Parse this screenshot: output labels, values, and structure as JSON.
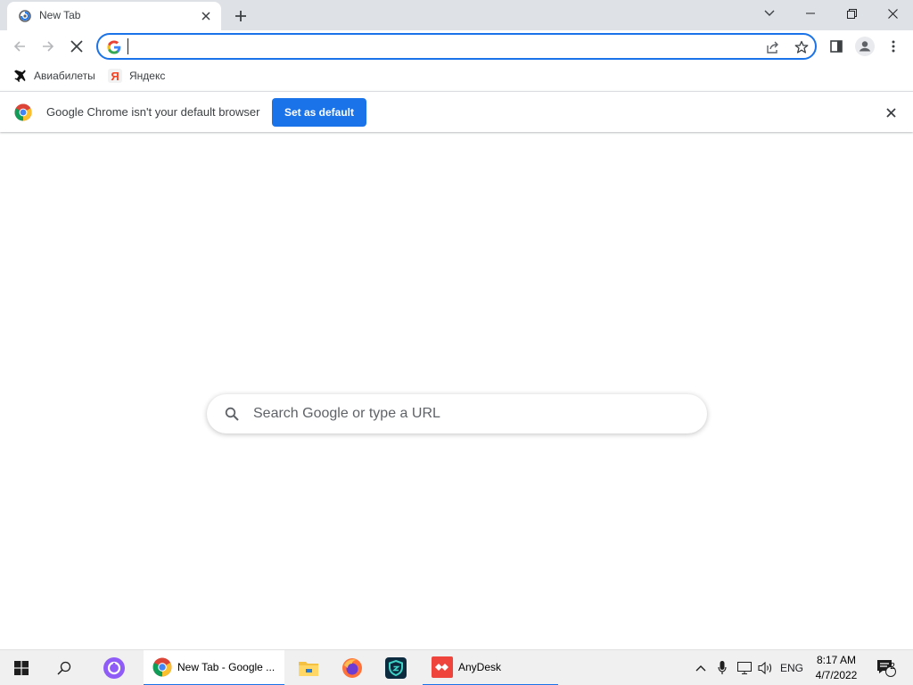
{
  "browser": {
    "tab": {
      "title": "New Tab",
      "favicon": "loading-spinner-icon",
      "close_icon": "close-icon"
    },
    "new_tab_icon": "plus-icon",
    "window_controls": [
      "chevron-down-icon",
      "minimize-icon",
      "restore-icon",
      "close-icon"
    ]
  },
  "toolbar": {
    "buttons": [
      "back-icon",
      "forward-icon",
      "stop-loading-icon"
    ],
    "omnibox": {
      "value": "",
      "placeholder": "",
      "leading_icon": "google-g-icon"
    },
    "omnibox_actions": [
      "share-icon",
      "bookmark-star-icon"
    ],
    "right_buttons": [
      "side-panel-icon",
      "profile-icon",
      "menu-icon"
    ]
  },
  "bookmarks": [
    {
      "label": "Авиабилеты",
      "icon": "airplane-icon"
    },
    {
      "label": "Яндекс",
      "icon": "yandex-icon"
    }
  ],
  "infobar": {
    "message": "Google Chrome isn't your default browser",
    "button": "Set as default",
    "logo": "chrome-logo-icon"
  },
  "ntp": {
    "search_placeholder": "Search Google or type a URL"
  },
  "taskbar": {
    "apps": [
      {
        "label": "New Tab - Google ...",
        "icon": "chrome-icon",
        "state": "active"
      },
      {
        "label": "",
        "icon": "file-explorer-icon"
      },
      {
        "label": "",
        "icon": "firefox-icon"
      },
      {
        "label": "",
        "icon": "shield-app-icon"
      },
      {
        "label": "AnyDesk",
        "icon": "anydesk-icon",
        "state": "open"
      }
    ],
    "language": "ENG",
    "time": "8:17 AM",
    "date": "4/7/2022",
    "notification_count": "2"
  },
  "colors": {
    "accent": "#1a73e8",
    "tabstrip": "#dee1e6",
    "taskbar": "#f0f0f0"
  }
}
